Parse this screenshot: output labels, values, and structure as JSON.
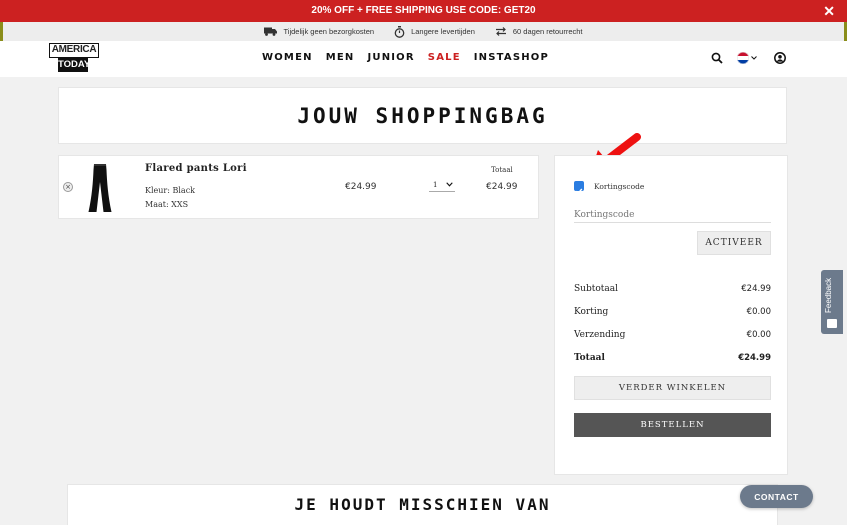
{
  "promo": {
    "text": "20% OFF + FREE SHIPPING USE CODE: GET20",
    "close": "✕"
  },
  "usps": [
    {
      "icon": "truck-icon",
      "text": "Tijdelijk geen bezorgkosten"
    },
    {
      "icon": "stopwatch-icon",
      "text": "Langere levertijden"
    },
    {
      "icon": "exchange-arrows-icon",
      "text": "60 dagen retourrecht"
    }
  ],
  "logo": {
    "top": "AMERICA",
    "bottom": "TODAY"
  },
  "nav": [
    "WOMEN",
    "MEN",
    "JUNIOR",
    "SALE",
    "INSTASHOP"
  ],
  "page_title": "JOUW SHOPPINGBAG",
  "cart": {
    "remove": "×",
    "items": [
      {
        "name": "Flared pants Lori",
        "color_label": "Kleur: Black",
        "size_label": "Maat: XXS",
        "price": "€24.99",
        "quantity": "1",
        "total_label": "Totaal",
        "total": "€24.99"
      }
    ]
  },
  "summary": {
    "discount_checkbox_label": "Kortingscode",
    "discount_placeholder": "Kortingscode",
    "activate_button": "ACTIVEER",
    "rows": [
      {
        "label": "Subtotaal",
        "value": "€24.99"
      },
      {
        "label": "Korting",
        "value": "€0.00"
      },
      {
        "label": "Verzending",
        "value": "€0.00"
      },
      {
        "label": "Totaal",
        "value": "€24.99"
      }
    ],
    "continue_button": "VERDER WINKELEN",
    "order_button": "BESTELLEN"
  },
  "feedback": "Feedback",
  "recommendations_title": "JE HOUDT MISSCHIEN VAN",
  "contact_button": "CONTACT",
  "colors": {
    "promo": "#cc2121",
    "sale": "#cc2121",
    "checkbox": "#2b7de1",
    "order_button": "#555555",
    "arrow": "#ee1111"
  }
}
